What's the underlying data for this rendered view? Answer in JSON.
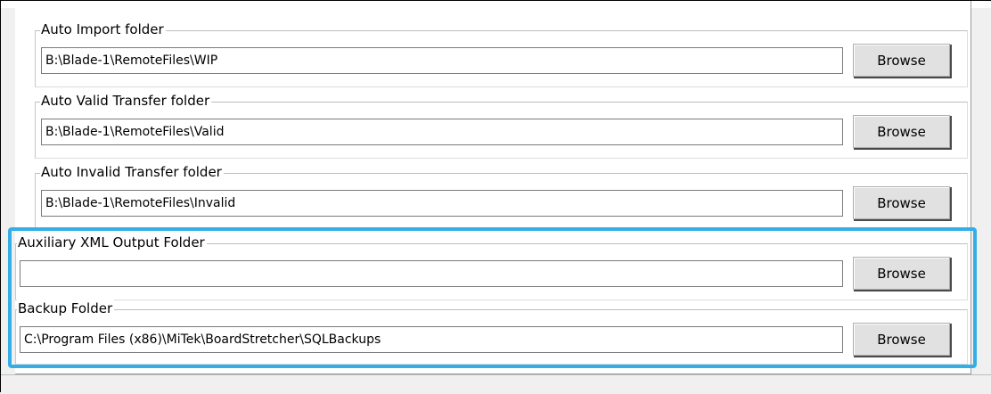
{
  "folders": [
    {
      "legend": "Auto Import folder",
      "value": "B:\\Blade-1\\RemoteFiles\\WIP",
      "browse_label": "Browse"
    },
    {
      "legend": "Auto Valid Transfer folder",
      "value": "B:\\Blade-1\\RemoteFiles\\Valid",
      "browse_label": "Browse"
    },
    {
      "legend": "Auto Invalid Transfer folder",
      "value": "B:\\Blade-1\\RemoteFiles\\Invalid",
      "browse_label": "Browse"
    },
    {
      "legend": "Auxiliary XML Output Folder",
      "value": "",
      "browse_label": "Browse"
    },
    {
      "legend": "Backup Folder",
      "value": "C:\\Program Files (x86)\\MiTek\\BoardStretcher\\SQLBackups",
      "browse_label": "Browse"
    }
  ],
  "highlight_color": "#34aee6"
}
